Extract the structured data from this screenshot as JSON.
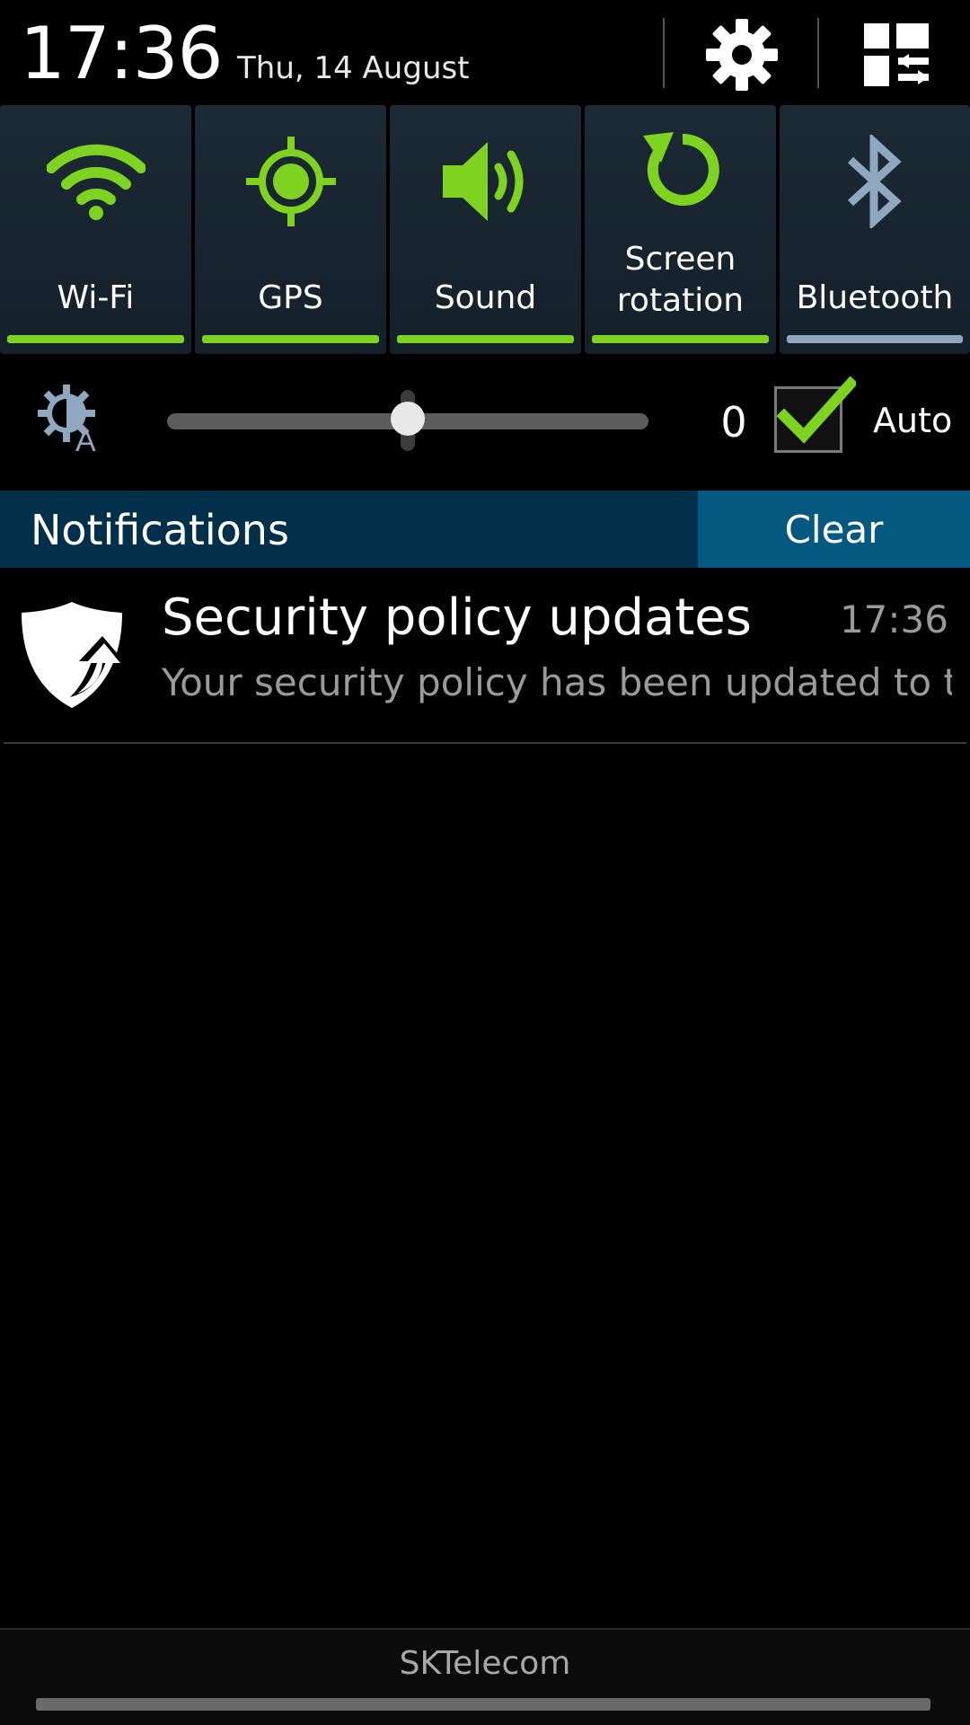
{
  "status": {
    "time": "17:36",
    "date": "Thu, 14 August"
  },
  "header_icons": {
    "settings": "gear-icon",
    "edit_panel": "quick-panel-edit-icon"
  },
  "toggles": [
    {
      "label": "Wi-Fi",
      "icon": "wifi-icon",
      "on": true
    },
    {
      "label": "GPS",
      "icon": "gps-icon",
      "on": true
    },
    {
      "label": "Sound",
      "icon": "speaker-icon",
      "on": true
    },
    {
      "label": "Screen rotation",
      "icon": "rotation-icon",
      "on": true
    },
    {
      "label": "Bluetooth",
      "icon": "bluetooth-icon",
      "on": false
    }
  ],
  "brightness": {
    "icon": "brightness-auto-icon",
    "level_fraction": 0.5,
    "value": "0",
    "auto_checked": true,
    "auto_label": "Auto"
  },
  "notifications": {
    "title": "Notifications",
    "clear_label": "Clear",
    "items": [
      {
        "icon": "shield-update-icon",
        "title": "Security policy updates",
        "time": "17:36",
        "text": "Your security policy has been updated to th.."
      }
    ]
  },
  "footer": {
    "carrier": "SKTelecom"
  },
  "colors": {
    "accent_green": "#7ed321",
    "inactive_blue": "#8fa8bf",
    "notif_header_bg": "#022f4a",
    "clear_bg": "#055880"
  }
}
